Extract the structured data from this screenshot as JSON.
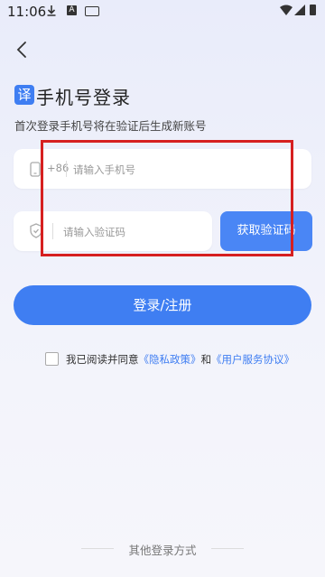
{
  "status_bar": {
    "time": "11:06",
    "a_badge": "A"
  },
  "header": {
    "badge": "译",
    "title": "手机号登录",
    "subtitle": "首次登录手机号将在验证后生成新账号"
  },
  "phone_field": {
    "country_code": "+86",
    "placeholder": "请输入手机号",
    "value": ""
  },
  "code_field": {
    "placeholder": "请输入验证码",
    "value": ""
  },
  "get_code_button": "获取验证码",
  "login_button": "登录/注册",
  "agreement": {
    "prefix": "我已阅读并同意",
    "privacy_link": "《隐私政策》",
    "connector": "和",
    "terms_link": "《用户服务协议》"
  },
  "other_login": "其他登录方式",
  "colors": {
    "accent": "#3f7ef2",
    "annotation": "#d62020"
  }
}
